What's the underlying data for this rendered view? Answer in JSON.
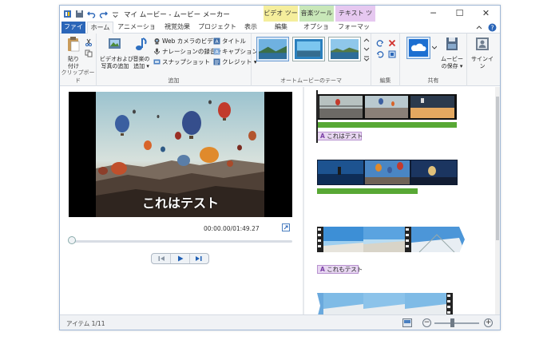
{
  "title_bar": {
    "app_title": "マイ ムービー - ムービー メーカー",
    "context_tabs": [
      {
        "label": "ビデオ ツール",
        "color": "#f5ee9c"
      },
      {
        "label": "音楽ツール",
        "color": "#c8e7b8"
      },
      {
        "label": "テキスト ツール",
        "color": "#e6c8f0"
      }
    ],
    "window_controls": {
      "minimize": "─",
      "maximize": "☐",
      "close": "✕"
    }
  },
  "ribbon_tabs": [
    "ファイル",
    "ホーム",
    "アニメーション",
    "視覚効果",
    "プロジェクト",
    "表示",
    "編集",
    "オプション",
    "フォーマット"
  ],
  "ribbon_active_tab": "ホーム",
  "clipboard": {
    "paste_label": "貼り\n付け",
    "group_label": "クリップボード"
  },
  "add_group": {
    "add_videos_label": "ビデオおよび\n写真の追加",
    "add_music_label": "音楽の\n追加 ▾",
    "webcam_label": "Web カメラのビデオ",
    "narration_label": "ナレーションの録音 ▾",
    "snapshot_label": "スナップショット",
    "title_label": "タイトル",
    "caption_label": "キャプション",
    "credits_label": "クレジット ▾",
    "group_label": "追加"
  },
  "themes_group": {
    "label": "オートムービーのテーマ"
  },
  "edit_group": {
    "label": "編集"
  },
  "share_group": {
    "label": "共有",
    "save_movie_label": "ムービー\nの保存 ▾"
  },
  "signin": {
    "label": "サインイン"
  },
  "preview": {
    "caption_text": "これはテスト",
    "time": "00:00.00/01:49.27",
    "progress_fraction": 0.0
  },
  "storyboard": {
    "captions": [
      "これはテスト",
      "これもテスト"
    ]
  },
  "status": {
    "item_text": "アイテム 1/11"
  },
  "zoom": {
    "minus": "−",
    "plus": "+"
  },
  "colors": {
    "accent": "#2b66b8",
    "audio_track": "#58a835",
    "caption_bg": "#e7d6f1"
  }
}
